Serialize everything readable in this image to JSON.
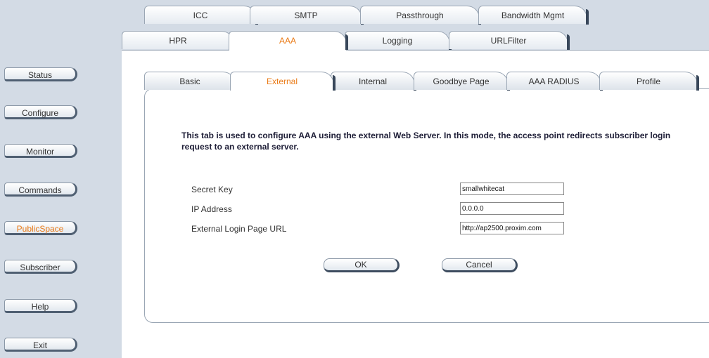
{
  "top_tabs_row1": [
    "ICC",
    "SMTP",
    "Passthrough",
    "Bandwidth Mgmt"
  ],
  "top_tabs_row2": [
    "HPR",
    "AAA",
    "Logging",
    "URLFilter"
  ],
  "sidebar": {
    "items": [
      "Status",
      "Configure",
      "Monitor",
      "Commands",
      "PublicSpace",
      "Subscriber",
      "Help",
      "Exit"
    ],
    "active": "PublicSpace"
  },
  "sub_tabs": [
    "Basic",
    "External",
    "Internal",
    "Goodbye Page",
    "AAA RADIUS",
    "Profile"
  ],
  "description": "This tab is used to configure AAA using the external Web Server. In this mode, the access point redirects subscriber login request to an external server.",
  "form": {
    "secret_key_label": "Secret Key",
    "secret_key_value": "smallwhitecat",
    "ip_address_label": "IP Address",
    "ip_address_value": "0.0.0.0",
    "login_url_label": "External Login Page URL",
    "login_url_value": "http://ap2500.proxim.com"
  },
  "buttons": {
    "ok": "OK",
    "cancel": "Cancel"
  },
  "colors": {
    "active_tab_text": "#ea7a16",
    "sidebar_bg": "#d3dbe5",
    "border": "#9aa6b4"
  }
}
